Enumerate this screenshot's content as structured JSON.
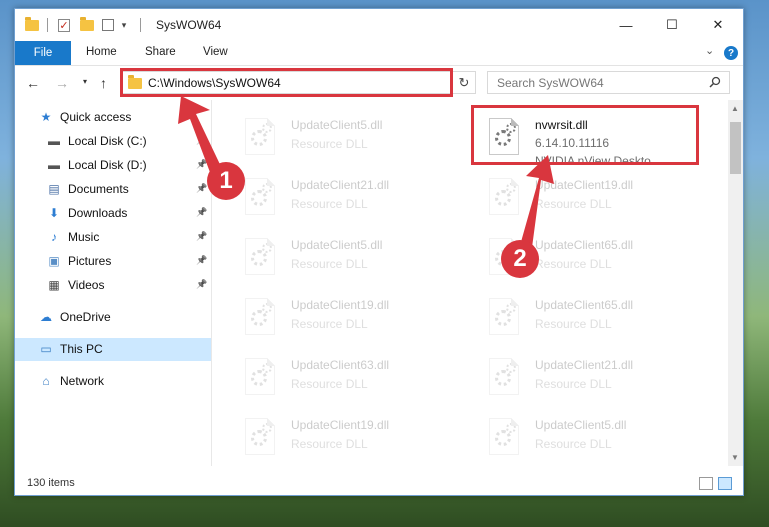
{
  "window": {
    "title": "SysWOW64",
    "controls": {
      "minimize": "—",
      "maximize": "☐",
      "close": "✕"
    }
  },
  "ribbon": {
    "file": "File",
    "tabs": [
      "Home",
      "Share",
      "View"
    ],
    "expand_glyph": "⌄"
  },
  "nav": {
    "address": "C:\\Windows\\SysWOW64",
    "search_placeholder": "Search SysWOW64"
  },
  "sidebar": {
    "items": [
      {
        "label": "Quick access",
        "icon": "star-icon",
        "pinned": false
      },
      {
        "label": "Local Disk (C:)",
        "icon": "drive-icon",
        "pinned": true
      },
      {
        "label": "Local Disk (D:)",
        "icon": "drive-icon",
        "pinned": true
      },
      {
        "label": "Documents",
        "icon": "documents-icon",
        "pinned": true
      },
      {
        "label": "Downloads",
        "icon": "download-icon",
        "pinned": true
      },
      {
        "label": "Music",
        "icon": "music-icon",
        "pinned": true
      },
      {
        "label": "Pictures",
        "icon": "pictures-icon",
        "pinned": true
      },
      {
        "label": "Videos",
        "icon": "videos-icon",
        "pinned": true
      },
      {
        "label": "OneDrive",
        "icon": "cloud-icon",
        "pinned": false
      },
      {
        "label": "This PC",
        "icon": "computer-icon",
        "pinned": false,
        "selected": true
      },
      {
        "label": "Network",
        "icon": "network-icon",
        "pinned": false
      }
    ]
  },
  "files": {
    "left": [
      {
        "name": "UpdateClient5.dll",
        "desc": "Resource DLL"
      },
      {
        "name": "UpdateClient21.dll",
        "desc": "Resource DLL"
      },
      {
        "name": "UpdateClient5.dll",
        "desc": "Resource DLL"
      },
      {
        "name": "UpdateClient19.dll",
        "desc": "Resource DLL"
      },
      {
        "name": "UpdateClient63.dll",
        "desc": "Resource DLL"
      },
      {
        "name": "UpdateClient19.dll",
        "desc": "Resource DLL"
      }
    ],
    "right": [
      {
        "name": "nvwrsit.dll",
        "desc": "6.14.10.11116",
        "desc2": "NVIDIA nView Deskto..."
      },
      {
        "name": "UpdateClient19.dll",
        "desc": "Resource DLL"
      },
      {
        "name": "UpdateClient65.dll",
        "desc": "Resource DLL"
      },
      {
        "name": "UpdateClient65.dll",
        "desc": "Resource DLL"
      },
      {
        "name": "UpdateClient21.dll",
        "desc": "Resource DLL"
      },
      {
        "name": "UpdateClient5.dll",
        "desc": "Resource DLL"
      }
    ]
  },
  "status": {
    "count": "130 items"
  },
  "annotations": {
    "step1": "1",
    "step2": "2",
    "color": "#d9363e"
  }
}
